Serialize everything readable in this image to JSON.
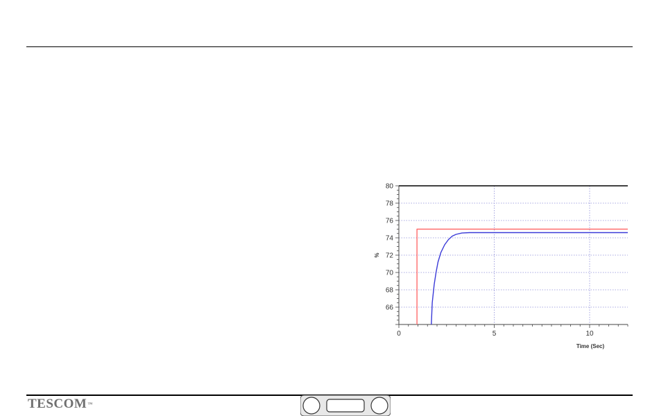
{
  "logo": {
    "text": "TESCOM",
    "tm": "™"
  },
  "chart_data": {
    "type": "line",
    "xlabel": "Time (Sec)",
    "ylabel": "%",
    "xlim": [
      0,
      12
    ],
    "ylim": [
      64,
      80
    ],
    "x_ticks": [
      0,
      5,
      10
    ],
    "y_ticks": [
      66,
      68,
      70,
      72,
      74,
      76,
      78,
      80
    ],
    "grid": true,
    "series": [
      {
        "color": "#ff6b6b",
        "points": [
          [
            0.95,
            64
          ],
          [
            0.95,
            75.0
          ],
          [
            12,
            75.0
          ]
        ]
      },
      {
        "color": "#3a3ad8",
        "points": [
          [
            1.7,
            64
          ],
          [
            1.75,
            66.5
          ],
          [
            1.85,
            68.6
          ],
          [
            1.95,
            70.0
          ],
          [
            2.05,
            71.2
          ],
          [
            2.2,
            72.3
          ],
          [
            2.4,
            73.2
          ],
          [
            2.6,
            73.8
          ],
          [
            2.8,
            74.2
          ],
          [
            3.0,
            74.4
          ],
          [
            3.3,
            74.55
          ],
          [
            3.7,
            74.6
          ],
          [
            5,
            74.6
          ],
          [
            8,
            74.6
          ],
          [
            12,
            74.6
          ]
        ]
      }
    ]
  },
  "colors": {
    "plot_border": "#000000",
    "grid": "#8d8dd8",
    "axis": "#444444"
  }
}
